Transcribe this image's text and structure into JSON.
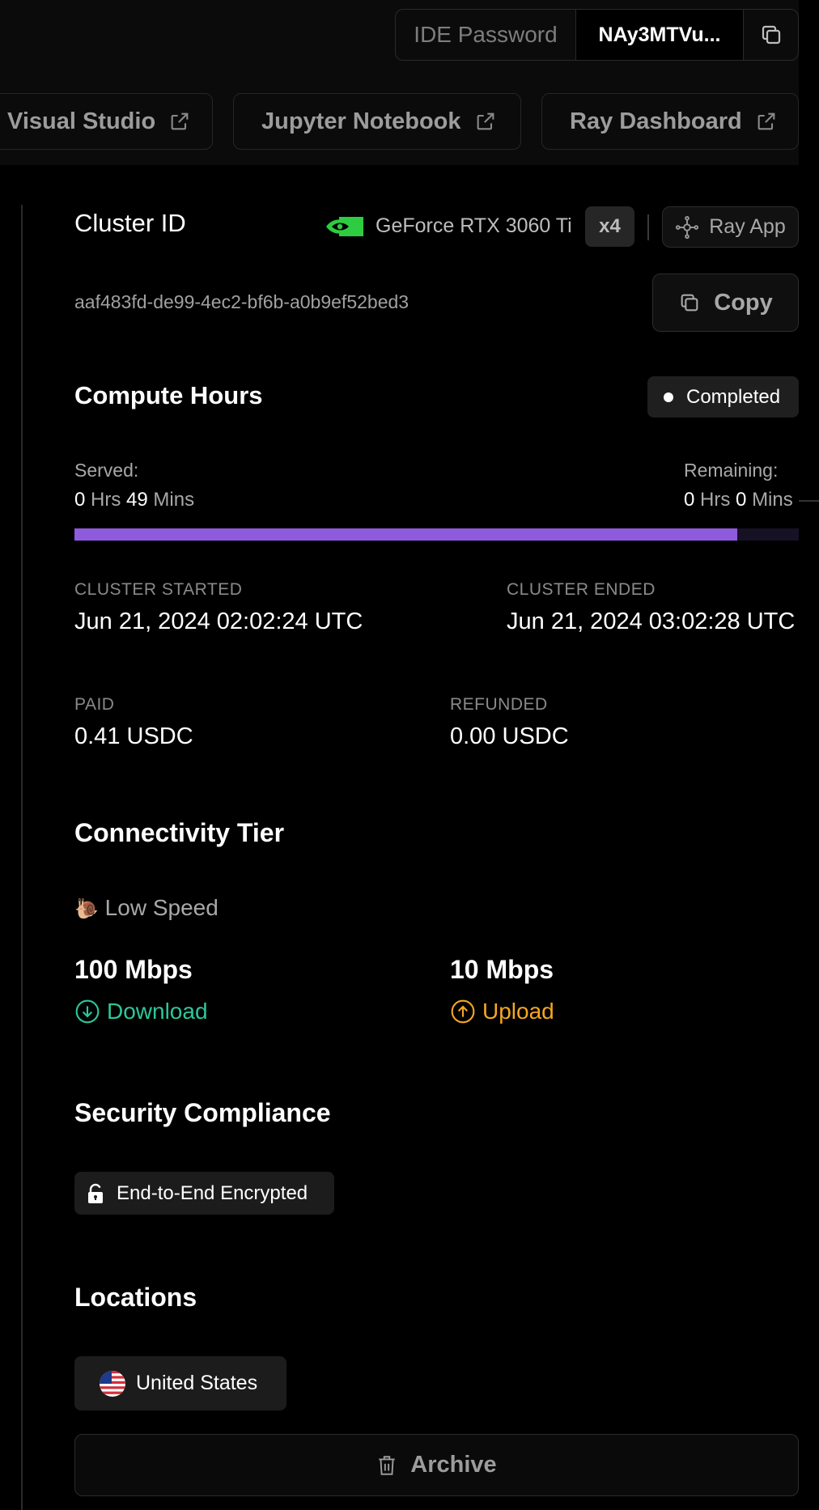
{
  "header": {
    "ide_password_label": "IDE Password",
    "ide_password_value": "NAy3MTVu...",
    "links": [
      {
        "label": "Visual Studio",
        "icon": "external-link-icon"
      },
      {
        "label": "Jupyter Notebook",
        "icon": "external-link-icon"
      },
      {
        "label": "Ray Dashboard",
        "icon": "external-link-icon"
      }
    ]
  },
  "cluster": {
    "title": "Cluster ID",
    "gpu_name": "GeForce RTX 3060 Ti",
    "gpu_count": "x4",
    "app_label": "Ray App",
    "id": "aaf483fd-de99-4ec2-bf6b-a0b9ef52bed3",
    "copy_label": "Copy"
  },
  "compute": {
    "title": "Compute Hours",
    "status": "Completed",
    "served_label": "Served:",
    "served_hrs": "0",
    "served_mins": "49",
    "remaining_label": "Remaining:",
    "remaining_hrs": "0",
    "remaining_mins": "0",
    "hrs_unit": "Hrs",
    "mins_unit": "Mins",
    "progress_fraction": 0.915,
    "started_label": "CLUSTER STARTED",
    "started_value": "Jun 21, 2024 02:02:24 UTC",
    "ended_label": "CLUSTER ENDED",
    "ended_value": "Jun 21, 2024 03:02:28 UTC",
    "paid_label": "PAID",
    "paid_value": "0.41 USDC",
    "refunded_label": "REFUNDED",
    "refunded_value": "0.00 USDC"
  },
  "connectivity": {
    "title": "Connectivity Tier",
    "tier_emoji": "🐌",
    "tier": "Low Speed",
    "download_value": "100 Mbps",
    "download_label": "Download",
    "upload_value": "10 Mbps",
    "upload_label": "Upload"
  },
  "security": {
    "title": "Security Compliance",
    "badge": "End-to-End Encrypted"
  },
  "locations": {
    "title": "Locations",
    "items": [
      "United States"
    ]
  },
  "actions": {
    "archive_label": "Archive"
  },
  "colors": {
    "accent_purple": "#8e5bdc",
    "download_green": "#2cc79a",
    "upload_orange": "#f5a623",
    "nvidia_green": "#2ecc40"
  }
}
